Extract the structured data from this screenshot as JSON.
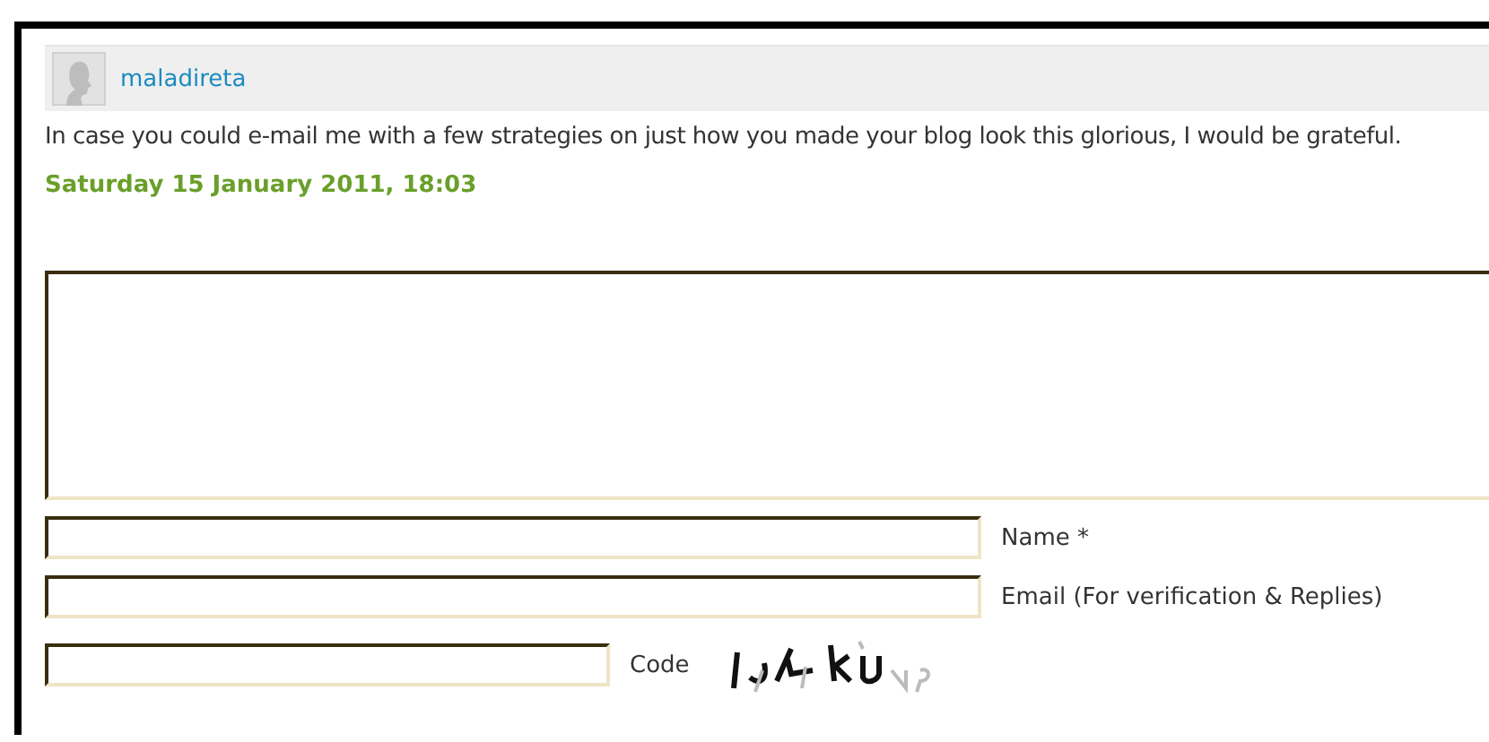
{
  "comment": {
    "author": "maladireta",
    "text": "In case you could e-mail me with a few strategies on just how you made your blog look this glorious, I would be grateful.",
    "date": "Saturday 15 January 2011, 18:03"
  },
  "form": {
    "fields": [
      {
        "kind": "short",
        "label": "Name *"
      },
      {
        "kind": "short",
        "label": "Email (For verification & Replies)"
      },
      {
        "kind": "captcha",
        "label": "Code"
      }
    ]
  }
}
